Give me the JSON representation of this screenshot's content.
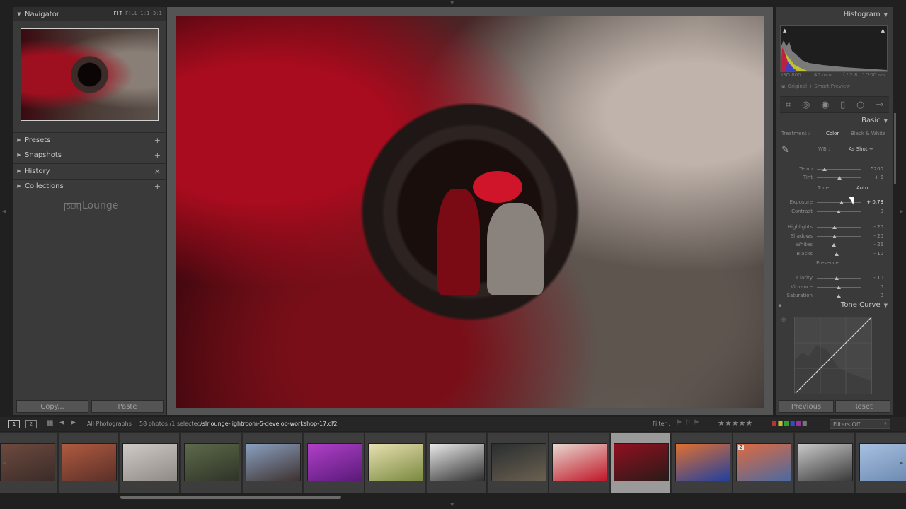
{
  "left_panel": {
    "navigator": {
      "title": "Navigator",
      "modes": [
        "FIT",
        "FILL",
        "1:1",
        "3:1"
      ]
    },
    "sections": [
      {
        "label": "Presets",
        "action": "+"
      },
      {
        "label": "Snapshots",
        "action": "+"
      },
      {
        "label": "History",
        "action": "×"
      },
      {
        "label": "Collections",
        "action": "+"
      }
    ],
    "logo": {
      "box": "SLR",
      "text": "Lounge"
    },
    "copy_label": "Copy...",
    "paste_label": "Paste"
  },
  "right_panel": {
    "histogram": {
      "title": "Histogram",
      "iso": "ISO 800",
      "focal": "40 mm",
      "aperture": "f / 2.8",
      "shutter": "1/200 sec",
      "smart_preview": "Original + Smart Preview"
    },
    "basic": {
      "title": "Basic",
      "treatment_label": "Treatment :",
      "treatment_color": "Color",
      "treatment_bw": "Black & White",
      "wb_label": "WB :",
      "wb_value": "As Shot ÷",
      "tone_label": "Tone",
      "auto_label": "Auto",
      "presence_label": "Presence",
      "sliders": [
        {
          "label": "Temp",
          "value": "5200",
          "pos": 0.18
        },
        {
          "label": "Tint",
          "value": "+ 5",
          "pos": 0.52
        },
        {
          "label": "Exposure",
          "value": "+ 0.73",
          "pos": 0.56
        },
        {
          "label": "Contrast",
          "value": "0",
          "pos": 0.5
        },
        {
          "label": "Highlights",
          "value": "- 20",
          "pos": 0.4
        },
        {
          "label": "Shadows",
          "value": "- 20",
          "pos": 0.4
        },
        {
          "label": "Whites",
          "value": "- 25",
          "pos": 0.38
        },
        {
          "label": "Blacks",
          "value": "- 10",
          "pos": 0.45
        },
        {
          "label": "Clarity",
          "value": "- 10",
          "pos": 0.45
        },
        {
          "label": "Vibrance",
          "value": "0",
          "pos": 0.5
        },
        {
          "label": "Saturation",
          "value": "0",
          "pos": 0.5
        }
      ]
    },
    "tone_curve": {
      "title": "Tone Curve"
    },
    "previous_label": "Previous",
    "reset_label": "Reset"
  },
  "filmstrip_bar": {
    "page1": "1",
    "page2": "2",
    "source": "All Photographs",
    "count": "58 photos /1 selected",
    "filename": "/slrlounge-lightroom-5-develop-workshop-17.cr2",
    "filter_label": "Filter :",
    "filter_value": "Filters Off"
  },
  "filmstrip": {
    "selected_index": 10,
    "thumbs": [
      {
        "badge": "",
        "color_a": "#6e4a3e",
        "color_b": "#3a2c28"
      },
      {
        "badge": "",
        "color_a": "#b05a40",
        "color_b": "#5a3028"
      },
      {
        "badge": "",
        "color_a": "#cfcac6",
        "color_b": "#8f8a86"
      },
      {
        "badge": "",
        "color_a": "#5d6a4a",
        "color_b": "#2f3428"
      },
      {
        "badge": "",
        "color_a": "#8aa0c0",
        "color_b": "#3e3230"
      },
      {
        "badge": "",
        "color_a": "#b040c8",
        "color_b": "#5a1a7a"
      },
      {
        "badge": "",
        "color_a": "#e8e0b0",
        "color_b": "#7a8a40"
      },
      {
        "badge": "",
        "color_a": "#e8e8e8",
        "color_b": "#303030"
      },
      {
        "badge": "",
        "color_a": "#2a2e30",
        "color_b": "#6a6050"
      },
      {
        "badge": "",
        "color_a": "#e8d8d0",
        "color_b": "#c01828"
      },
      {
        "badge": "",
        "color_a": "#901020",
        "color_b": "#2a1a18"
      },
      {
        "badge": "",
        "color_a": "#e07030",
        "color_b": "#2040a0"
      },
      {
        "badge": "2",
        "color_a": "#e06a40",
        "color_b": "#4a6aa0"
      },
      {
        "badge": "",
        "color_a": "#c8c8c8",
        "color_b": "#3a3a3a"
      },
      {
        "badge": "",
        "color_a": "#a8c0e0",
        "color_b": "#6a88b0"
      }
    ]
  }
}
